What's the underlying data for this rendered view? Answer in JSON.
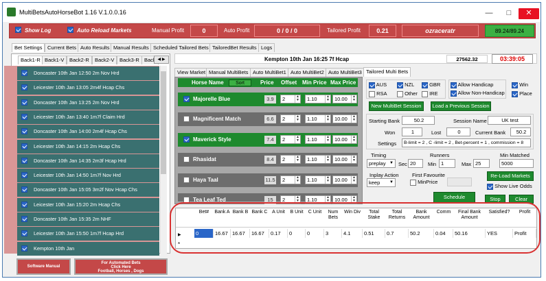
{
  "window": {
    "title": "MultiBetsAutoHorseBot 1.16 V.1.0.0.16"
  },
  "topbar": {
    "show_log": "Show Log",
    "auto_reload": "Auto Reload Markets",
    "manual_profit_label": "Manual Profit",
    "manual_profit_value": "0",
    "auto_profit_label": "Auto Profit",
    "auto_profit_value": "0 / 0 / 0",
    "tailored_profit_label": "Tailored Profit",
    "tailored_profit_value": "0.21",
    "username": "ozraceratr",
    "balance": "89.24/89.24"
  },
  "main_tabs": [
    "Bet Settings",
    "Current Bets",
    "Auto Results",
    "Manual Results",
    "Scheduled Tailored Bets",
    "TailoredBet Results",
    "Logs"
  ],
  "back_tabs": [
    "Back1-R",
    "Back1-V",
    "Back2-R",
    "Back2-V",
    "Back3-R",
    "Back"
  ],
  "races": [
    "Doncaster 10th Jan 12:50 2m Nov Hrd",
    "Leicester 10th Jan 13:05 2m4f Hcap Chs",
    "Doncaster 10th Jan 13:25 2m Nov Hrd",
    "Leicester 10th Jan 13:40 1m7f Claim Hrd",
    "Doncaster 10th Jan 14:00 2m4f Hcap Chs",
    "Leicester 10th Jan 14:15 2m Hcap Chs",
    "Doncaster 10th Jan 14:35 2m3f Hcap Hrd",
    "Leicester 10th Jan 14:50 1m7f Nov Hrd",
    "Doncaster 10th Jan 15:05 3m2f Nov Hcap Chs",
    "Leicester 10th Jan 15:20 2m Hcap Chs",
    "Doncaster 10th Jan 15:35 2m NHF",
    "Leicester 10th Jan 15:50 1m7f Hcap Hrd",
    "Kempton 10th Jan"
  ],
  "bottom_buttons": {
    "software_manual": "Software Manual",
    "automated_line1": "For Automated Bets",
    "automated_line2": "Click Here",
    "automated_line3": "Football, Horses , Dogs"
  },
  "market": {
    "title": "Kempton 10th Jan 16:25 7f Hcap",
    "amount": "27562.32",
    "countdown": "03:39:05"
  },
  "view_tabs": [
    "View Market",
    "Manual MultiBets",
    "Auto MultiBet1",
    "Auto MultiBet2",
    "Auto MultiBet3",
    "Tailored Multi Bets"
  ],
  "horse_table": {
    "headers": {
      "name": "Horse Name",
      "sort": "Sort",
      "price": "Price",
      "offset": "Offset",
      "min": "Min Price",
      "max": "Max Price"
    },
    "rows": [
      {
        "name": "Majorelle Blue",
        "price": "3.9",
        "offset": "2",
        "min": "1.10",
        "max": "10.00",
        "checked": true
      },
      {
        "name": "Magnificent Match",
        "price": "6.6",
        "offset": "2",
        "min": "1.10",
        "max": "10.00",
        "checked": false
      },
      {
        "name": "Maverick Style",
        "price": "7.4",
        "offset": "2",
        "min": "1.10",
        "max": "10.00",
        "checked": true
      },
      {
        "name": "Rhasidat",
        "price": "8.4",
        "offset": "2",
        "min": "1.10",
        "max": "10.00",
        "checked": false
      },
      {
        "name": "Haya Taal",
        "price": "11.5",
        "offset": "2",
        "min": "1.10",
        "max": "10.00",
        "checked": false
      },
      {
        "name": "Tea Leaf Ted",
        "price": "15",
        "offset": "2",
        "min": "1.10",
        "max": "10.00",
        "checked": false
      }
    ]
  },
  "filters": {
    "aus": "AUS",
    "nzl": "NZL",
    "gbr": "GBR",
    "rsa": "RSA",
    "other": "Other",
    "ire": "IRE",
    "allow_handicap": "Allow Handicap",
    "allow_non_handicap": "Allow Non-Handicap",
    "win": "Win",
    "place": "Place"
  },
  "session": {
    "new_button": "New MultiBet Session",
    "load_button": "Load a Previous Session",
    "starting_bank_label": "Starting Bank",
    "starting_bank": "50.2",
    "session_name_label": "Session Name",
    "session_name": "UK test",
    "won_label": "Won",
    "won": "1",
    "lost_label": "Lost",
    "lost": "0",
    "current_bank_label": "Current Bank",
    "current_bank": "50.2",
    "settings_label": "Settings",
    "settings": "B-limit = 2 , C -limit = 2 , Bet-percent = 1 , commission = 8"
  },
  "timing": {
    "timing_label": "Timing",
    "timing_value": "preplay",
    "sec_label": "Sec",
    "sec_value": "20",
    "runners_label": "Runners",
    "min_label": "Min",
    "min_value": "1",
    "max_label": "Max",
    "max_value": "25",
    "min_matched_label": "Min Matched",
    "min_matched_value": "5000",
    "inplay_label": "Inplay Action",
    "inplay_value": "keep",
    "first_fav_label": "First Favourite",
    "min_price_label": "MinPrice",
    "reload_button": "Re-Load Markets",
    "show_live_odds": "Show Live Odds",
    "schedule_button": "Schedule",
    "stop_button": "Stop",
    "clear_button": "Clear"
  },
  "grid": {
    "headers": [
      "Bet#",
      "Bank A",
      "Bank B",
      "Bank C",
      "A Unit",
      "B Unit",
      "C Unit",
      "Num Bets",
      "Win Div",
      "Total Stake",
      "Total Returns",
      "Bank Amount",
      "Comm",
      "Final Bank Amount",
      "Satisfied?",
      "Profit"
    ],
    "row": [
      "0",
      "16.67",
      "16.67",
      "16.67",
      "0.17",
      "0",
      "0",
      "3",
      "4.1",
      "0.51",
      "0.7",
      "50.2",
      "0.04",
      "50.16",
      "YES",
      "Profit"
    ]
  }
}
